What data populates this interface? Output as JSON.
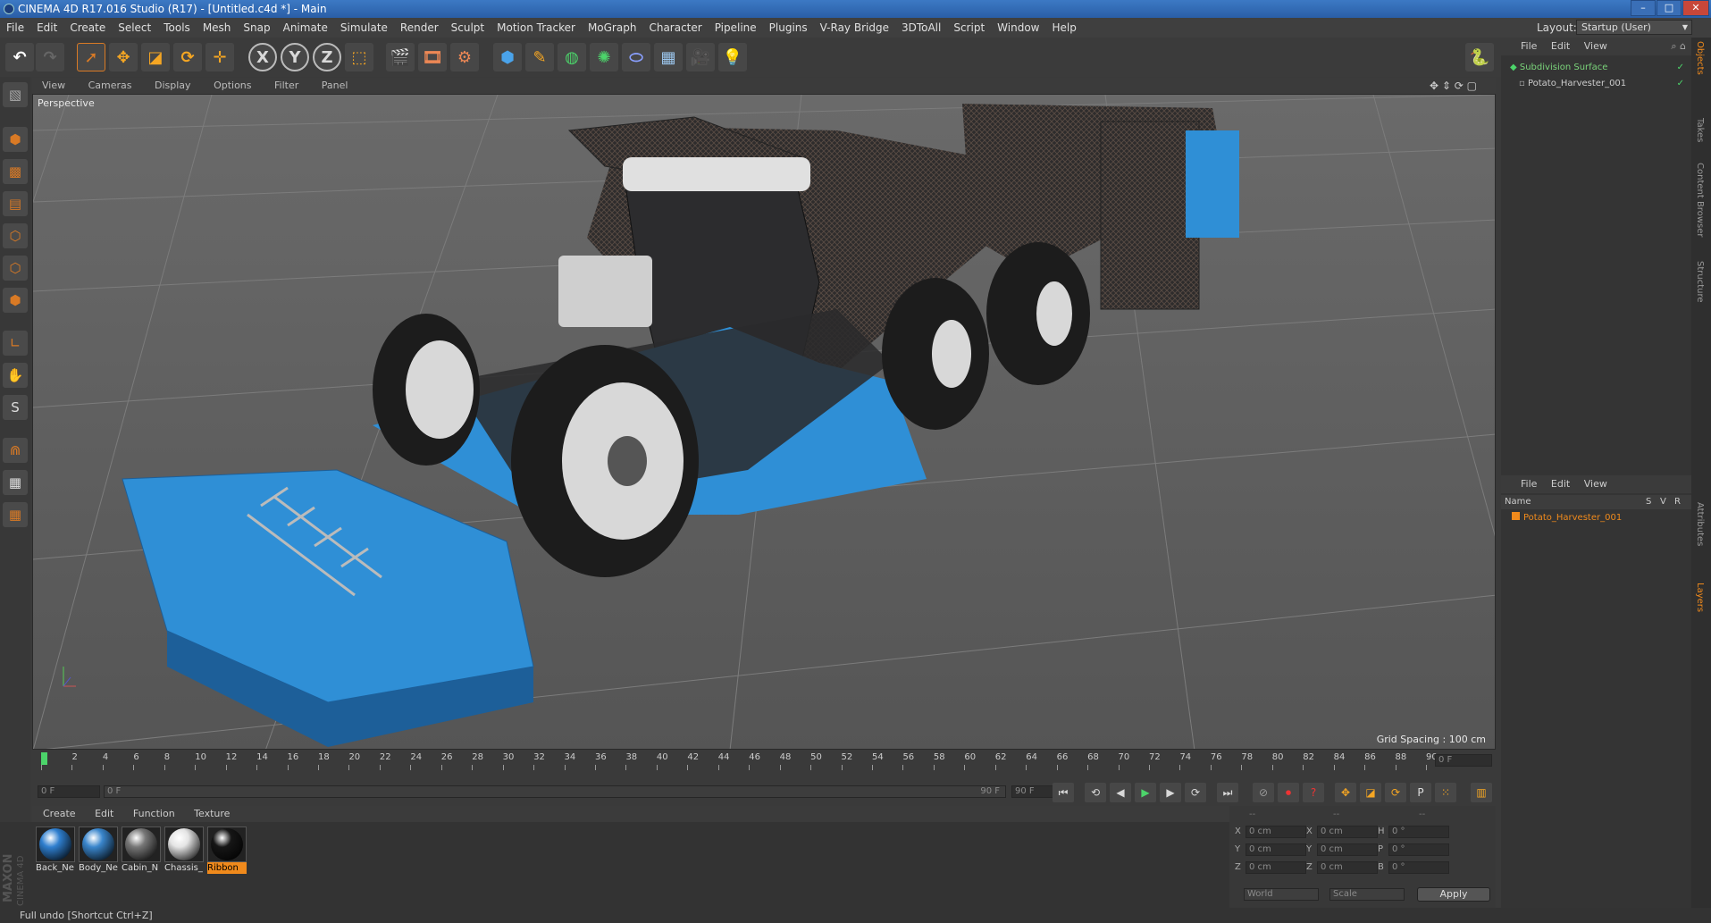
{
  "window": {
    "title": "CINEMA 4D R17.016 Studio (R17) - [Untitled.c4d *] - Main",
    "controls": {
      "minimize": "–",
      "maximize": "□",
      "close": "✕"
    }
  },
  "menubar": {
    "items": [
      "File",
      "Edit",
      "Create",
      "Select",
      "Tools",
      "Mesh",
      "Snap",
      "Animate",
      "Simulate",
      "Render",
      "Sculpt",
      "Motion Tracker",
      "MoGraph",
      "Character",
      "Pipeline",
      "Plugins",
      "V-Ray Bridge",
      "3DToAll",
      "Script",
      "Window",
      "Help"
    ]
  },
  "layout": {
    "label": "Layout:",
    "value": "Startup (User)"
  },
  "toolbar": {
    "icons": [
      "undo-icon",
      "redo-icon",
      "live-select-icon",
      "move-icon",
      "scale-icon",
      "rotate-icon",
      "recent-tool-icon",
      "x-axis-icon",
      "y-axis-icon",
      "z-axis-icon",
      "world-coords-icon",
      "render-view-icon",
      "render-picture-viewer-icon",
      "edit-render-settings-icon",
      "cube-icon",
      "pen-icon",
      "subdivision-icon",
      "array-icon",
      "deformer-icon",
      "floor-icon",
      "camera-icon",
      "light-icon",
      "python-icon"
    ],
    "axis_labels": [
      "X",
      "Y",
      "Z"
    ]
  },
  "viewport": {
    "menu": [
      "View",
      "Cameras",
      "Display",
      "Options",
      "Filter",
      "Panel"
    ],
    "label": "Perspective",
    "grid_spacing": "Grid Spacing : 100 cm",
    "colors": {
      "body_blue": "#2f8fd6",
      "dark_metal": "#2c2c2e",
      "tire": "#1c1c1c",
      "rim": "#d8d8d8",
      "tank": "#cfcfcf"
    }
  },
  "timeline": {
    "ticks": [
      "0",
      "2",
      "4",
      "6",
      "8",
      "10",
      "12",
      "14",
      "16",
      "18",
      "20",
      "22",
      "24",
      "26",
      "28",
      "30",
      "32",
      "34",
      "36",
      "38",
      "40",
      "42",
      "44",
      "46",
      "48",
      "50",
      "52",
      "54",
      "56",
      "58",
      "60",
      "62",
      "64",
      "66",
      "68",
      "70",
      "72",
      "74",
      "76",
      "78",
      "80",
      "82",
      "84",
      "86",
      "88",
      "90"
    ],
    "current_frame": "0 F",
    "start_field": "0 F",
    "range_start": "0 F",
    "range_end": "90 F",
    "end_field": "90 F"
  },
  "materials": {
    "menu": [
      "Create",
      "Edit",
      "Function",
      "Texture"
    ],
    "items": [
      {
        "label": "Back_Ne",
        "color": "#2f7fcf"
      },
      {
        "label": "Body_Ne",
        "color": "#3a86cc"
      },
      {
        "label": "Cabin_N",
        "color": "#777777"
      },
      {
        "label": "Chassis_",
        "color": "#e4e4e4"
      },
      {
        "label": "Ribbon",
        "color": "#161616",
        "selected": true
      }
    ]
  },
  "coordinates": {
    "header": [
      "--",
      "--",
      "--"
    ],
    "rows": [
      {
        "a": "X",
        "av": "0 cm",
        "b": "X",
        "bv": "0 cm",
        "c": "H",
        "cv": "0 °"
      },
      {
        "a": "Y",
        "av": "0 cm",
        "b": "Y",
        "bv": "0 cm",
        "c": "P",
        "cv": "0 °"
      },
      {
        "a": "Z",
        "av": "0 cm",
        "b": "Z",
        "bv": "0 cm",
        "c": "B",
        "cv": "0 °"
      }
    ],
    "mode": "World",
    "size_mode": "Scale",
    "apply": "Apply"
  },
  "object_manager": {
    "menu": [
      "File",
      "Edit",
      "View"
    ],
    "objects": [
      {
        "name": "Subdivision Surface",
        "color": "#7ad37a"
      },
      {
        "name": "Potato_Harvester_001",
        "color": "#cccccc"
      }
    ]
  },
  "layer_manager": {
    "menu": [
      "File",
      "Edit",
      "View"
    ],
    "columns": [
      "Name",
      "S",
      "V",
      "R"
    ],
    "layers": [
      {
        "name": "Potato_Harvester_001",
        "color": "#f08a1c"
      }
    ]
  },
  "side_tabs": [
    "Objects",
    "Takes",
    "Content Browser",
    "Structure",
    "Attributes",
    "Layers"
  ],
  "branding": {
    "maxon": "MAXON",
    "product": "CINEMA 4D"
  },
  "status": {
    "text": "Full undo [Shortcut Ctrl+Z]"
  }
}
